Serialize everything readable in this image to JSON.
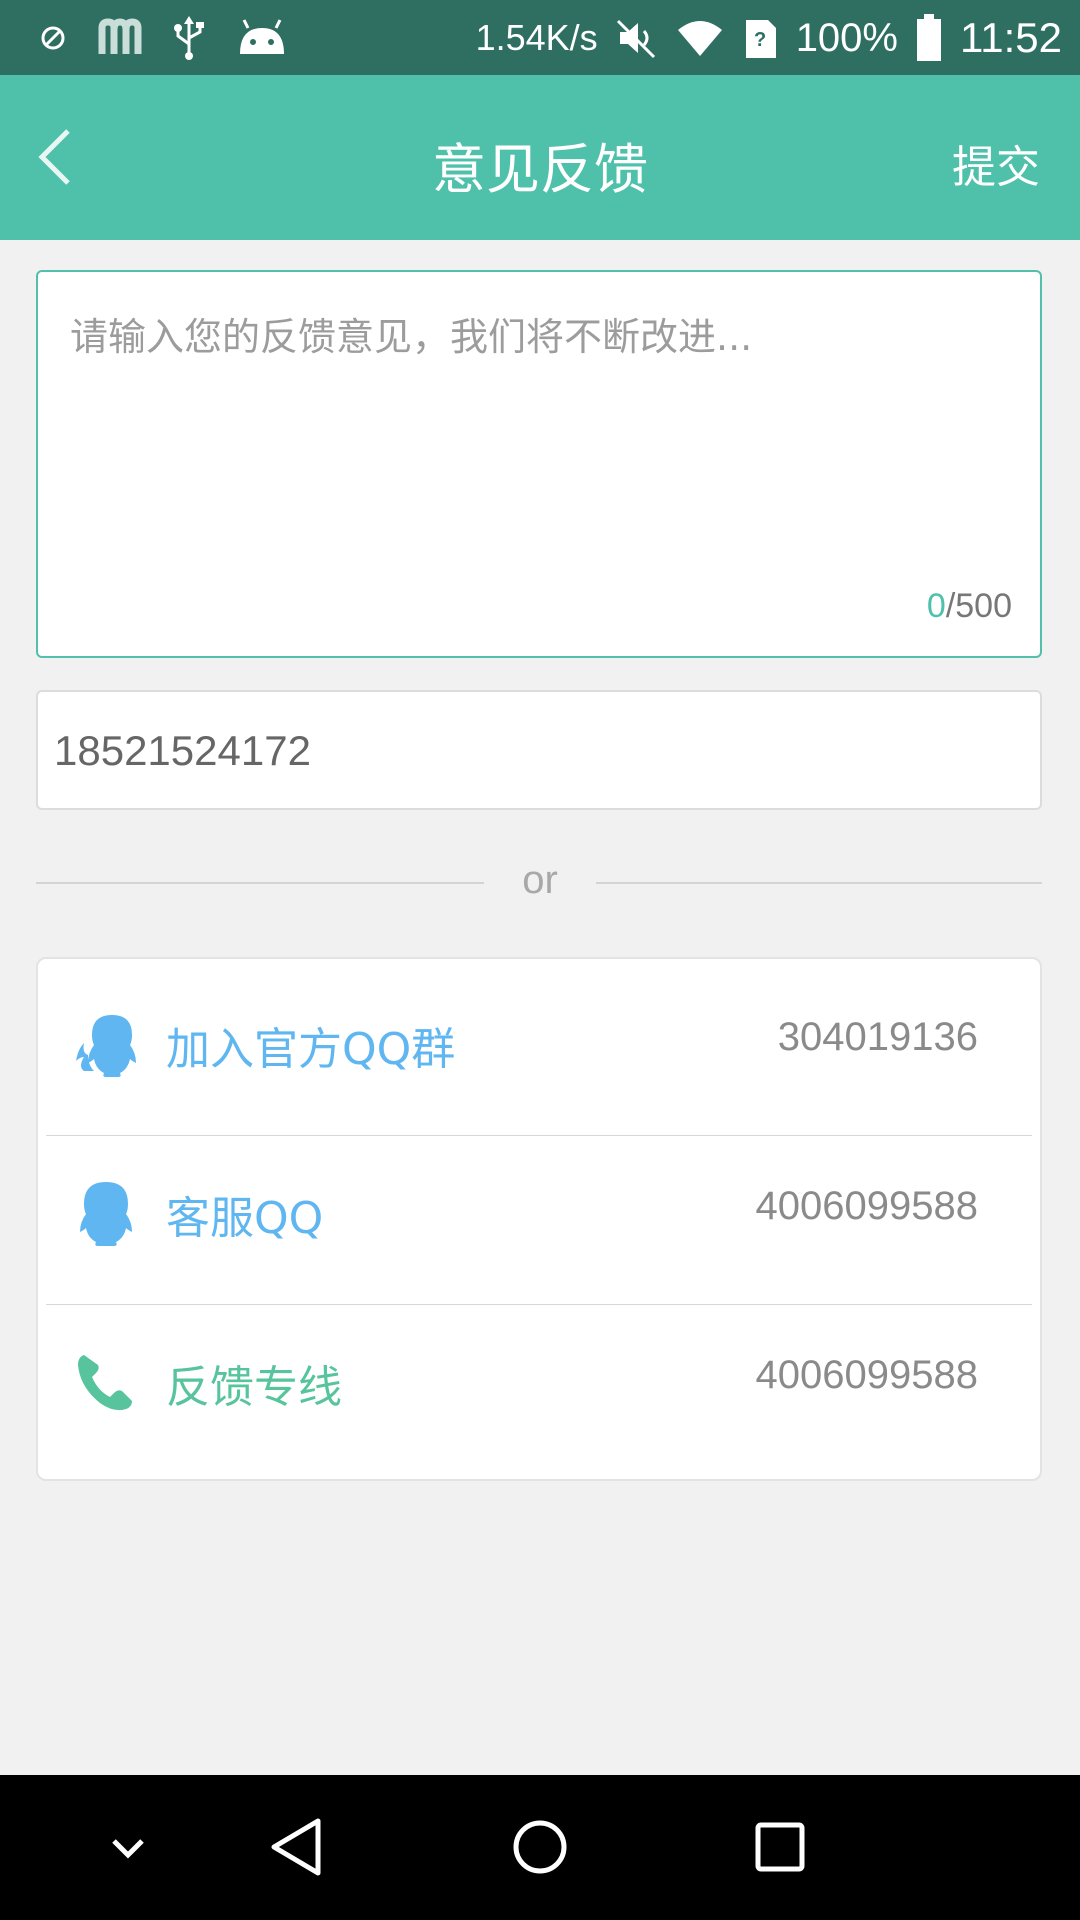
{
  "status_bar": {
    "network_speed": "1.54K/s",
    "battery": "100%",
    "time": "11:52",
    "icons": [
      "block-icon",
      "m-app-icon",
      "usb-icon",
      "android-icon",
      "mute-icon",
      "wifi-icon",
      "sim-unknown-icon",
      "battery-icon"
    ]
  },
  "app_bar": {
    "title": "意见反馈",
    "submit_label": "提交"
  },
  "feedback": {
    "placeholder": "请输入您的反馈意见，我们将不断改进...",
    "value": "",
    "count_current": "0",
    "count_max": "/500"
  },
  "contact_field": {
    "value": "18521524172"
  },
  "separator": {
    "text": "or"
  },
  "contacts": [
    {
      "icon": "qq-group-icon",
      "label": "加入官方QQ群",
      "value": "304019136",
      "color": "#5fb6f0"
    },
    {
      "icon": "qq-icon",
      "label": "客服QQ",
      "value": "4006099588",
      "color": "#5fb6f0"
    },
    {
      "icon": "phone-icon",
      "label": "反馈专线",
      "value": "4006099588",
      "color": "#57c49d"
    }
  ],
  "colors": {
    "status_bar": "#2f6f62",
    "app_bar": "#4fc1ab",
    "accent": "#4fc1ab",
    "background": "#f1f1f1"
  },
  "nav_bar": {
    "icons": [
      "collapse-icon",
      "back-triangle-icon",
      "home-circle-icon",
      "recents-square-icon"
    ]
  }
}
